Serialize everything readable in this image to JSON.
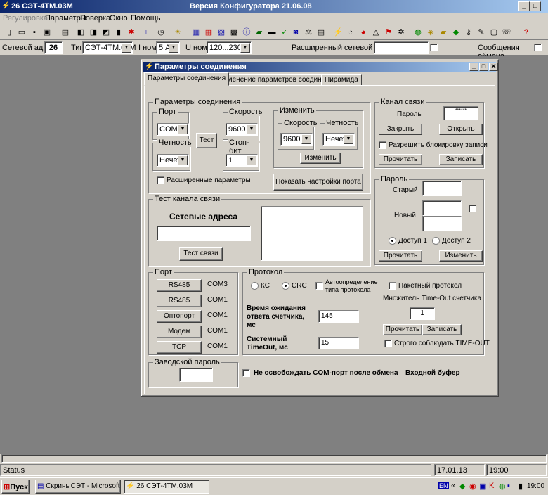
{
  "window": {
    "title_left": "26  СЭТ-4ТМ.03М",
    "title_center": "Версия Конфигуратора  21.06.08"
  },
  "menu": [
    "Регулировка",
    "Параметры",
    "Поверка",
    "Окно",
    "Помощь"
  ],
  "infobar": {
    "addr_label": "Сетевой адрес",
    "addr_value": "26",
    "type_label": "Тип",
    "type_value": "СЭТ-4ТМ.03М",
    "inom_label": "I ном.",
    "inom_value": "5 А",
    "unom_label": "U ном.",
    "unom_value": "120...230 В",
    "ext_label": "Расширенный сетевой адрес",
    "msg_label": "Сообщения обмена"
  },
  "dialog": {
    "title": "Параметры соединения",
    "tabs": [
      "Параметры соединения",
      "Изменение параметров соединения",
      "Пирамида"
    ],
    "conn": {
      "legend": "Параметры соединения",
      "port_legend": "Порт",
      "port_value": "COM3",
      "speed_legend": "Скорость",
      "speed_value": "9600",
      "parity_legend": "Четность",
      "parity_value": "Нечет",
      "stop_legend": "Стоп-бит",
      "stop_value": "1",
      "test_btn": "Тест",
      "change_legend": "Изменить",
      "ch_speed_legend": "Скорость",
      "ch_speed_value": "9600",
      "ch_parity_legend": "Четность",
      "ch_parity_value": "Нечет",
      "change_btn": "Изменить",
      "ext_params": "Расширенные параметры",
      "show_port_btn": "Показать настройки порта"
    },
    "channel": {
      "legend": "Канал связи",
      "pwd_label": "Пароль",
      "pwd_value": "******",
      "close_btn": "Закрыть",
      "open_btn": "Открыть",
      "allow_block": "Разрешить блокировку записи",
      "read_btn": "Прочитать",
      "write_btn": "Записать"
    },
    "test": {
      "legend": "Тест канала связи",
      "addr_title": "Сетевые адреса",
      "test_btn": "Тест связи"
    },
    "password": {
      "legend": "Пароль",
      "old_label": "Старый",
      "new_label": "Новый",
      "access1": "Доступ 1",
      "access2": "Доступ 2",
      "read_btn": "Прочитать",
      "change_btn": "Изменить"
    },
    "ports": {
      "legend": "Порт",
      "items": [
        {
          "btn": "RS485",
          "val": "COM3"
        },
        {
          "btn": "RS485",
          "val": "COM1"
        },
        {
          "btn": "Оптопорт",
          "val": "COM1"
        },
        {
          "btn": "Модем",
          "val": "COM1"
        },
        {
          "btn": "TCP",
          "val": "COM1"
        }
      ]
    },
    "protocol": {
      "legend": "Протокол",
      "kc": "КС",
      "crc": "CRC",
      "autodetect": "Автоопределение типа протокола",
      "packet": "Пакетный протокол",
      "multiplier": "Множитель Time-Out счетчика",
      "multiplier_value": "1",
      "wait_label": "Время ожидания ответа счетчика, мс",
      "wait_value": "145",
      "sys_label": "Системный TimeOut, мс",
      "sys_value": "15",
      "read_btn": "Прочитать",
      "write_btn": "Записать",
      "strict": "Строго соблюдать TIME-OUT"
    },
    "factory": {
      "legend": "Заводской пароль"
    },
    "keep_port": "Не освобождать COM-порт после обмена",
    "input_buffer": "Входной буфер"
  },
  "status": {
    "text": "Status",
    "date": "17.01.13",
    "time": "19:00"
  },
  "taskbar": {
    "start": "Пуск",
    "task1": "СкриныСЭТ - Microsoft ...",
    "task2": "26  СЭТ-4ТМ.03М",
    "clock": "19:00",
    "lang": "EN"
  }
}
